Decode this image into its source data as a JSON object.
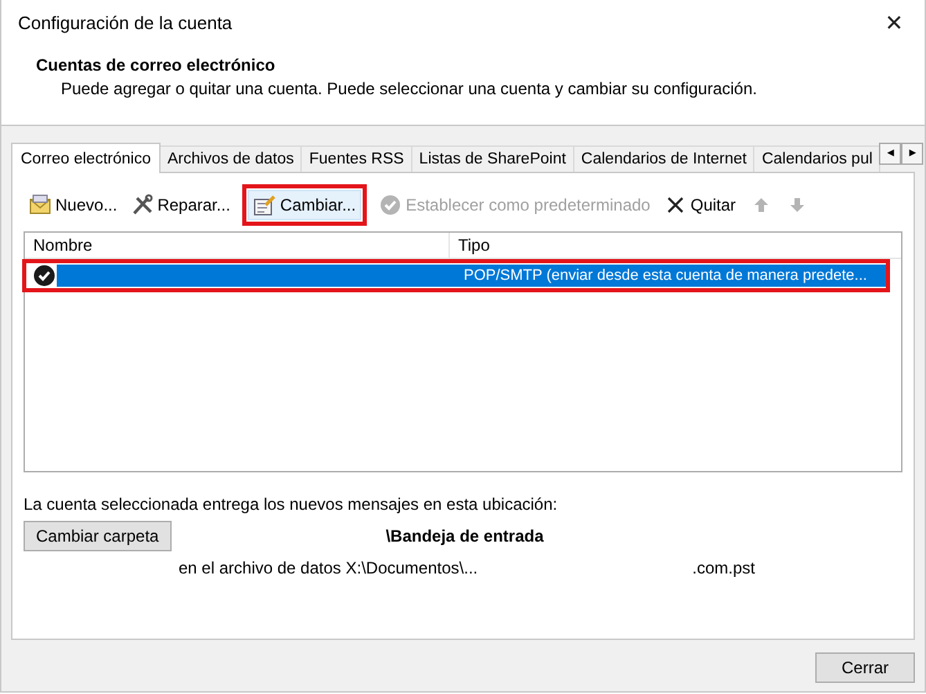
{
  "window": {
    "title": "Configuración de la cuenta",
    "close": "✕"
  },
  "header": {
    "title": "Cuentas de correo electrónico",
    "description": "Puede agregar o quitar una cuenta. Puede seleccionar una cuenta y cambiar su configuración."
  },
  "tabs": [
    {
      "label": "Correo electrónico",
      "selected": true
    },
    {
      "label": "Archivos de datos",
      "selected": false
    },
    {
      "label": "Fuentes RSS",
      "selected": false
    },
    {
      "label": "Listas de SharePoint",
      "selected": false
    },
    {
      "label": "Calendarios de Internet",
      "selected": false
    },
    {
      "label": "Calendarios pul",
      "selected": false
    }
  ],
  "tab_scroll": [
    "◂",
    "▸"
  ],
  "toolbar": [
    {
      "kind": "new",
      "label": "Nuevo...",
      "disabled": false,
      "highlighted": false
    },
    {
      "kind": "repair",
      "label": "Reparar...",
      "disabled": false,
      "highlighted": false
    },
    {
      "kind": "change",
      "label": "Cambiar...",
      "disabled": false,
      "highlighted": true
    },
    {
      "kind": "default",
      "label": "Establecer como predeterminado",
      "disabled": true,
      "highlighted": false
    },
    {
      "kind": "remove",
      "label": "Quitar",
      "disabled": false,
      "highlighted": false
    },
    {
      "kind": "up",
      "disabled": true,
      "highlighted": false
    },
    {
      "kind": "down",
      "disabled": true,
      "highlighted": false
    }
  ],
  "accounts": {
    "columns": [
      "Nombre",
      "Tipo"
    ],
    "rows": [
      {
        "type": "POP/SMTP (enviar desde esta cuenta de manera predete...",
        "selected": true,
        "highlighted": true
      }
    ]
  },
  "delivery": {
    "label": "La cuenta seleccionada entrega los nuevos mensajes en esta ubicación:",
    "button": "Cambiar carpeta",
    "folder": "\\Bandeja de entrada",
    "path_start": "en el archivo de datos X:\\Documentos\\...",
    "path_end": ".com.pst"
  },
  "buttons": [
    "Cerrar"
  ]
}
